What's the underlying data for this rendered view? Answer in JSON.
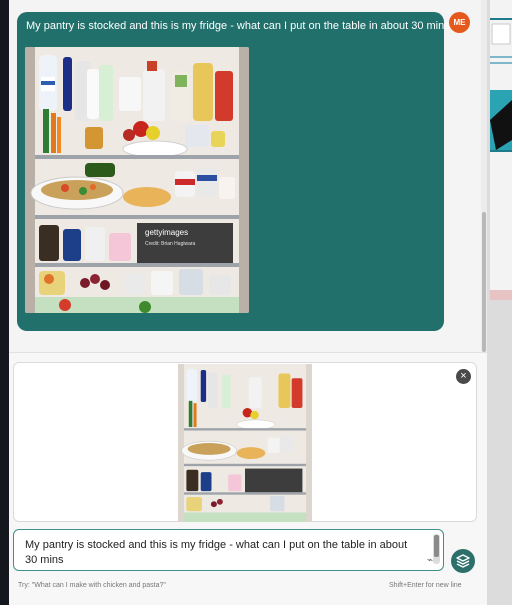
{
  "message": {
    "text": "My pantry is stocked and this is my fridge - what can I put on the table in about 30 mins",
    "avatar_initials": "ME"
  },
  "image": {
    "watermark_brand": "gettyimages",
    "watermark_credit": "Credit: Brian Hagiwara"
  },
  "composer": {
    "input_value": "My pantry is stocked and this is my fridge - what can I put on the table in about 30 mins",
    "hint_left": "Try: \"What can I make with chicken and pasta?\"",
    "hint_right": "Shift+Enter for new line"
  },
  "colors": {
    "bubble": "#21706c",
    "avatar": "#e55a1c",
    "send_button": "#2d6f6b",
    "input_border": "#3f8f8a"
  },
  "icons": [
    "close-icon",
    "paperclip-icon",
    "layers-icon"
  ]
}
